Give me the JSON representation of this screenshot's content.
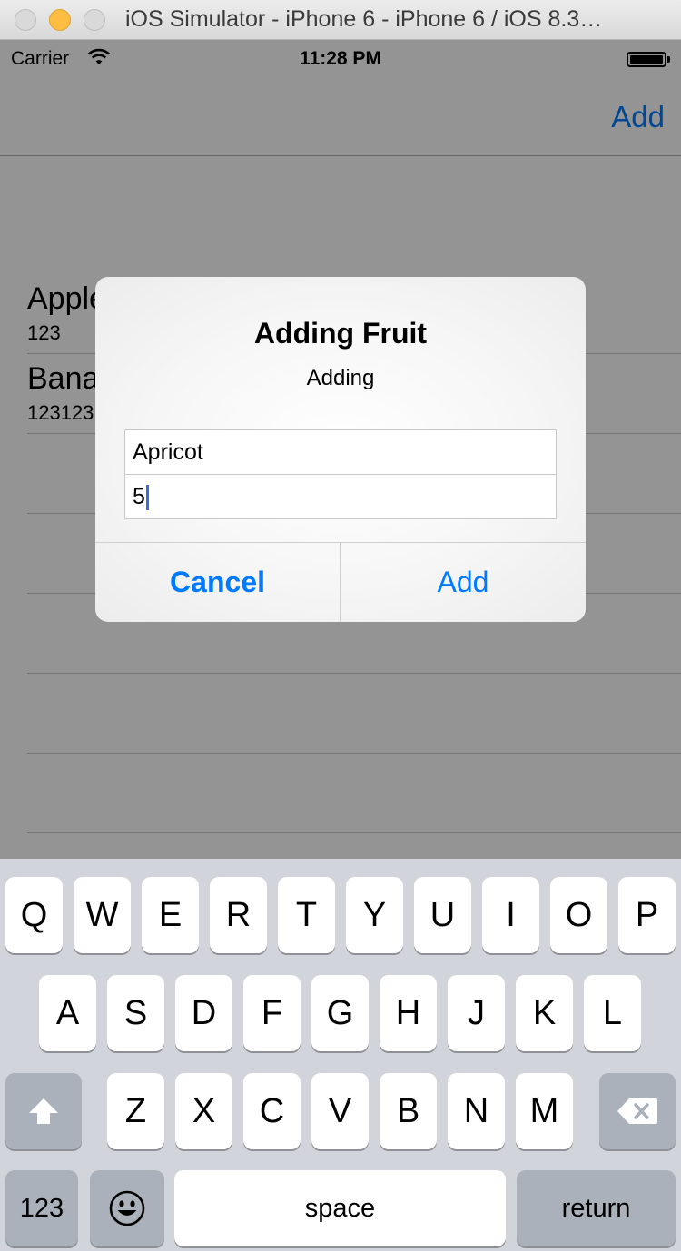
{
  "window": {
    "title": "iOS Simulator - iPhone 6 - iPhone 6 / iOS 8.3…"
  },
  "status_bar": {
    "carrier": "Carrier",
    "time": "11:28 PM",
    "wifi_icon": "wifi-icon",
    "battery_icon": "battery-icon"
  },
  "nav_bar": {
    "add_label": "Add"
  },
  "list": {
    "items": [
      {
        "title": "Apple",
        "subtitle": "123"
      },
      {
        "title": "Banana",
        "subtitle": "123123"
      }
    ]
  },
  "alert": {
    "title": "Adding Fruit",
    "message": "Adding",
    "field_name_value": "Apricot",
    "field_count_value": "5",
    "cancel_label": "Cancel",
    "add_label": "Add"
  },
  "keyboard": {
    "row1": [
      "Q",
      "W",
      "E",
      "R",
      "T",
      "Y",
      "U",
      "I",
      "O",
      "P"
    ],
    "row2": [
      "A",
      "S",
      "D",
      "F",
      "G",
      "H",
      "J",
      "K",
      "L"
    ],
    "row3": [
      "Z",
      "X",
      "C",
      "V",
      "B",
      "N",
      "M"
    ],
    "numbers_label": "123",
    "space_label": "space",
    "return_label": "return",
    "shift_icon": "shift-icon",
    "delete_icon": "delete-icon",
    "emoji_icon": "emoji-icon"
  },
  "colors": {
    "ios_blue": "#007aff",
    "keyboard_bg": "#d1d5db",
    "dark_key": "#abb1ba"
  }
}
